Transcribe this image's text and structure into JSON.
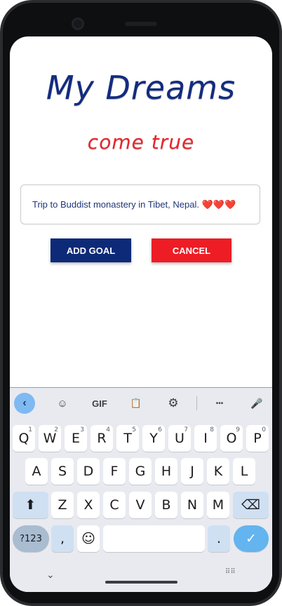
{
  "app": {
    "title": "My Dreams",
    "subtitle": "come true"
  },
  "goal_input": {
    "value": "Trip to Buddist monastery in Tibet, Nepal. ❤️❤️❤️"
  },
  "buttons": {
    "add": "ADD GOAL",
    "cancel": "CANCEL"
  },
  "keyboard": {
    "toolbar": {
      "back": "‹",
      "sticker": "☺",
      "gif": "GIF",
      "clipboard": "📋",
      "settings": "⚙",
      "more": "•••",
      "mic": "🎤"
    },
    "row1": [
      "Q",
      "W",
      "E",
      "R",
      "T",
      "Y",
      "U",
      "I",
      "O",
      "P"
    ],
    "row1_hints": [
      "1",
      "2",
      "3",
      "4",
      "5",
      "6",
      "7",
      "8",
      "9",
      "0"
    ],
    "row2": [
      "A",
      "S",
      "D",
      "F",
      "G",
      "H",
      "J",
      "K",
      "L"
    ],
    "row3": [
      "Z",
      "X",
      "C",
      "V",
      "B",
      "N",
      "M"
    ],
    "shift": "⬆",
    "backspace": "⌫",
    "symbols": "?123",
    "comma": ",",
    "emoji": "☺",
    "period": ".",
    "enter": "✓",
    "nav_chevron": "⌄",
    "nav_grid": "⠿⠿"
  },
  "colors": {
    "title": "#132c80",
    "subtitle": "#e8252b",
    "add_button": "#0d2a78",
    "cancel_button": "#ee1c25",
    "enter_key": "#63b4ef"
  }
}
